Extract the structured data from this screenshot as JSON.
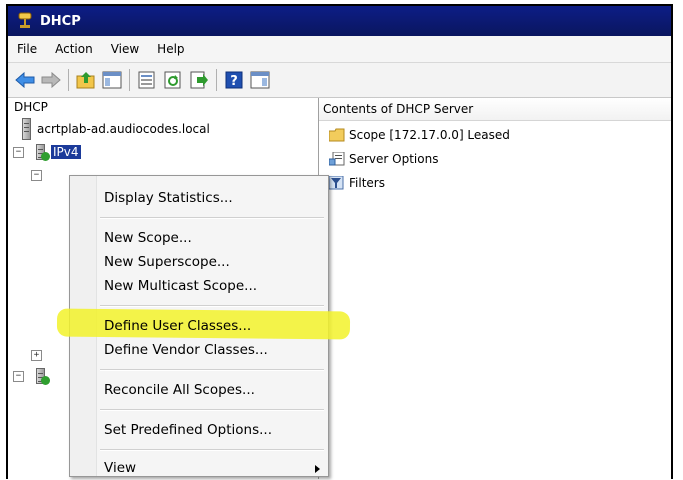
{
  "window": {
    "title": "DHCP"
  },
  "menubar": {
    "items": [
      "File",
      "Action",
      "View",
      "Help"
    ]
  },
  "toolbar": {
    "icons": [
      "back-arrow-icon",
      "forward-arrow-icon",
      "up-folder-icon",
      "show-hide-tree-icon",
      "properties-icon",
      "refresh-icon",
      "export-list-icon",
      "help-icon",
      "show-hide-action-pane-icon"
    ]
  },
  "tree": {
    "root_label": "DHCP",
    "server_label": "acrtplab-ad.audiocodes.local",
    "ipv4_label": "IPv4"
  },
  "content": {
    "header": "Contents of DHCP Server",
    "items": [
      {
        "label": "Scope [172.17.0.0] Leased",
        "icon": "folder-icon"
      },
      {
        "label": "Server Options",
        "icon": "server-options-icon"
      },
      {
        "label": "Filters",
        "icon": "filter-icon"
      }
    ]
  },
  "context_menu": {
    "items": [
      "Display Statistics...",
      "New Scope...",
      "New Superscope...",
      "New Multicast Scope...",
      "Define User Classes...",
      "Define Vendor Classes...",
      "Reconcile All Scopes...",
      "Set Predefined Options...",
      "View"
    ],
    "highlight_color": "#f2f22a"
  }
}
